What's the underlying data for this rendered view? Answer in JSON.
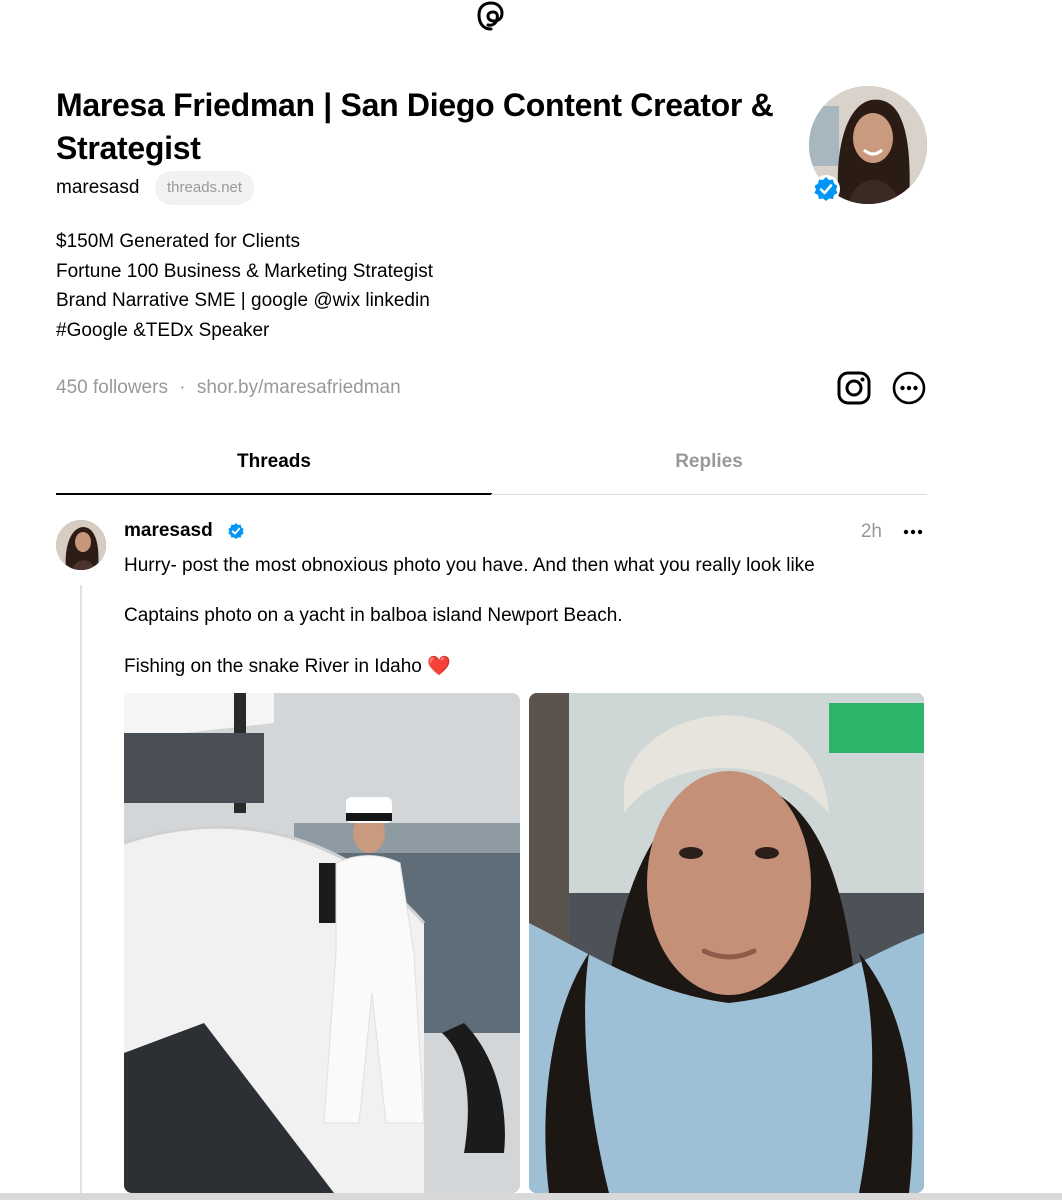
{
  "app": {
    "logo_icon": "threads-logo-icon"
  },
  "profile": {
    "name": "Maresa Friedman | San Diego Content Creator & Strategist",
    "handle": "maresasd",
    "domain_badge": "threads.net",
    "verified": true,
    "bio": [
      "$150M Generated for Clients",
      "Fortune 100 Business & Marketing Strategist",
      "Brand Narrative SME | google @wix linkedin",
      "#Google &TEDx Speaker"
    ],
    "followers": "450 followers",
    "separator": "·",
    "link": "shor.by/maresafriedman"
  },
  "tabs": [
    {
      "label": "Threads",
      "active": true
    },
    {
      "label": "Replies",
      "active": false
    }
  ],
  "post": {
    "author": "maresasd",
    "verified": true,
    "time": "2h",
    "lines": [
      "Hurry- post the most obnoxious photo you have.  And then what you really look like",
      "Captains photo on a yacht in balboa island Newport Beach.",
      "Fishing on the snake River in Idaho ❤️"
    ],
    "photos": [
      {
        "subject": "woman in white outfit and captain hat on a yacht"
      },
      {
        "subject": "selfie of woman in headscarf in a car"
      }
    ]
  },
  "colors": {
    "verified_blue": "#0095f6",
    "muted_text": "#999999",
    "badge_bg": "#f2f2f2"
  }
}
